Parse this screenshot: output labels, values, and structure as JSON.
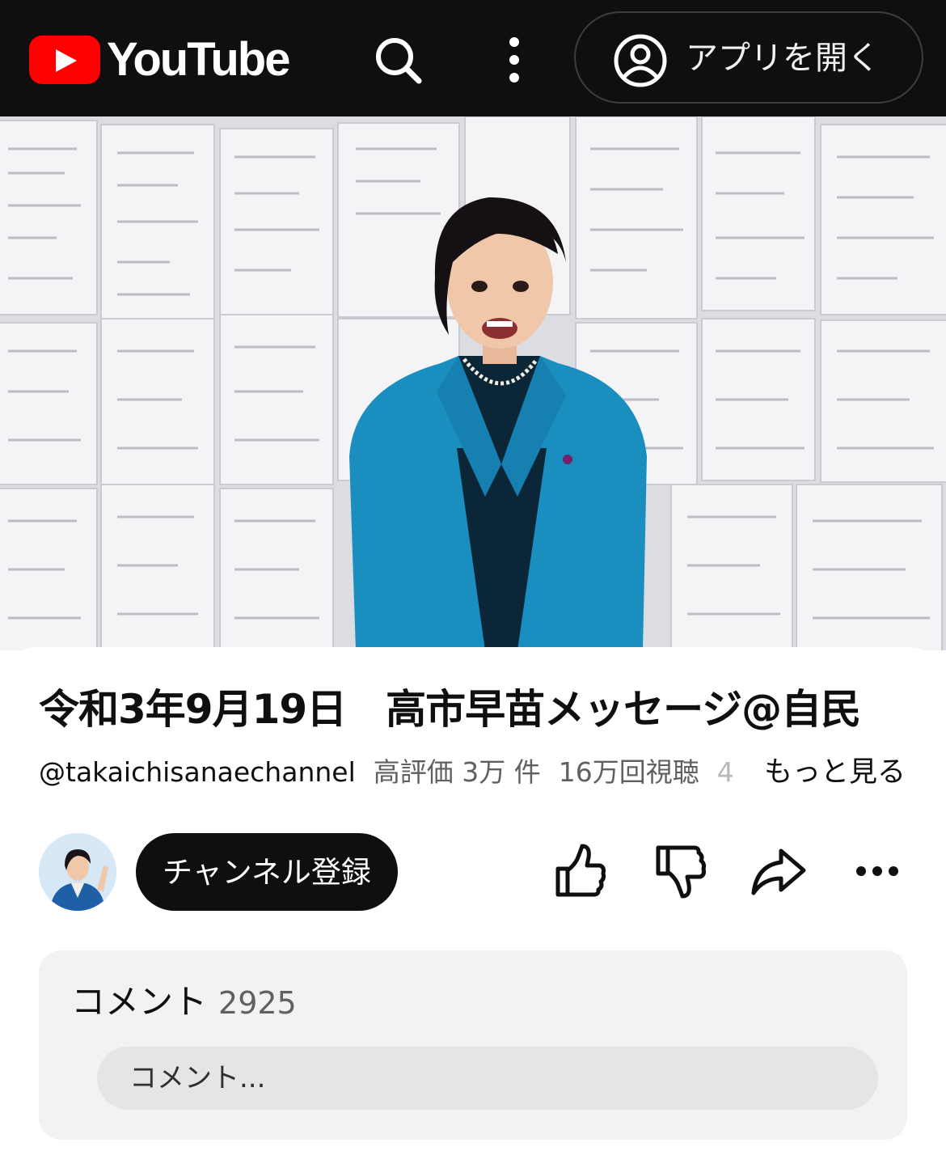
{
  "header": {
    "logo_text": "YouTube",
    "open_app_label": "アプリを開く",
    "icons": [
      "youtube-play-icon",
      "search-icon",
      "more-vert-icon",
      "account-icon"
    ]
  },
  "video": {
    "title": "令和3年9月19日　高市早苗メッセージ@自民"
  },
  "meta": {
    "handle": "@takaichisanaechannel",
    "likes": "高評価 3万 件",
    "views": "16万回視聴",
    "truncated": "4",
    "more": "もっと見る"
  },
  "actions": {
    "subscribe_label": "チャンネル登録",
    "icons": [
      "thumbs-up-icon",
      "thumbs-down-icon",
      "share-icon",
      "more-horiz-icon"
    ]
  },
  "comments": {
    "label": "コメント",
    "count": "2925",
    "placeholder": "コメント..."
  },
  "colors": {
    "brand_red": "#ff0000",
    "topbar_bg": "#0f0f0f",
    "blazer": "#1a8fbf"
  }
}
